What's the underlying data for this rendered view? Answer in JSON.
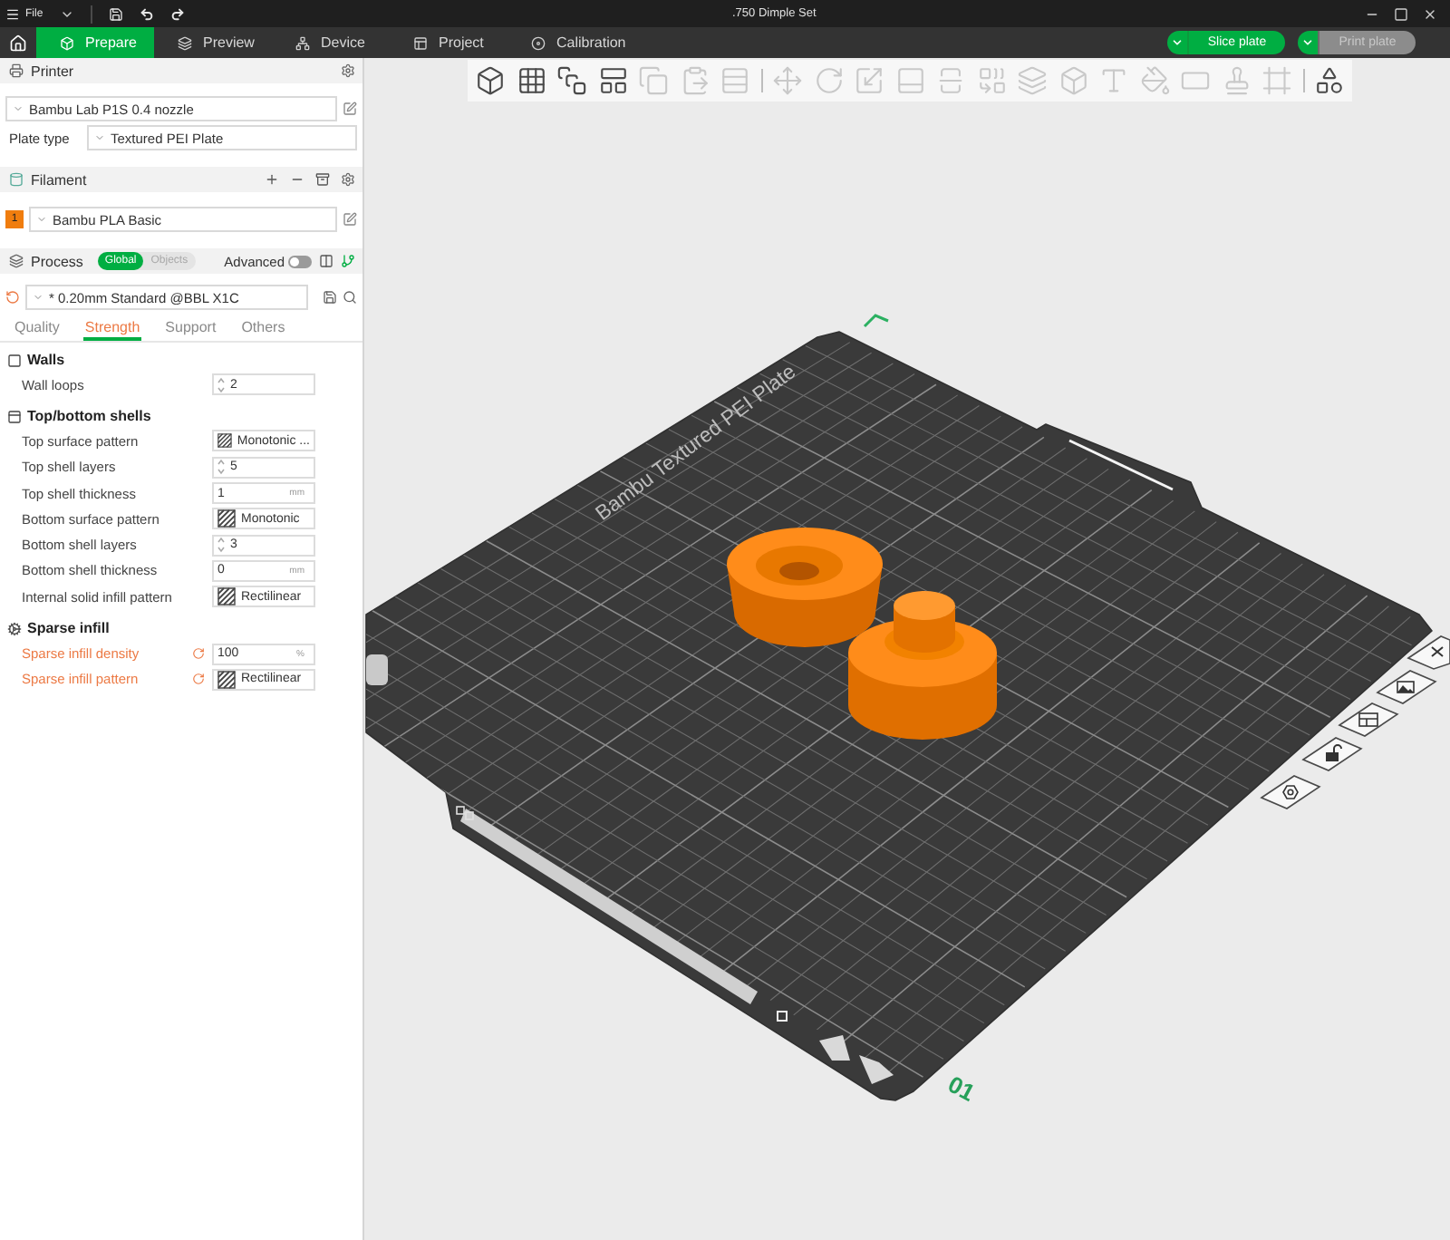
{
  "title_bar": {
    "menu": "File",
    "title": ".750 Dimple Set"
  },
  "tabs": [
    {
      "label": "Prepare",
      "selected": true
    },
    {
      "label": "Preview",
      "selected": false
    },
    {
      "label": "Device",
      "selected": false
    },
    {
      "label": "Project",
      "selected": false
    },
    {
      "label": "Calibration",
      "selected": false
    }
  ],
  "actions": [
    {
      "label": "Slice plate",
      "disabled": false
    },
    {
      "label": "Print plate",
      "disabled": true
    }
  ],
  "printer": {
    "title": "Printer",
    "preset": "Bambu Lab P1S 0.4 nozzle",
    "plate_type_label": "Plate type",
    "plate_type": "Textured PEI Plate"
  },
  "filament": {
    "title": "Filament",
    "items": [
      {
        "slot": "1",
        "name": "Bambu PLA Basic",
        "color": "#f07d0e"
      }
    ]
  },
  "process": {
    "title": "Process",
    "scope": [
      {
        "label": "Global",
        "selected": true
      },
      {
        "label": "Objects",
        "selected": false
      }
    ],
    "advanced_label": "Advanced",
    "advanced_on": false,
    "preset": "* 0.20mm Standard @BBL X1C"
  },
  "setting_tabs": [
    {
      "label": "Quality",
      "selected": false
    },
    {
      "label": "Strength",
      "selected": true
    },
    {
      "label": "Support",
      "selected": false
    },
    {
      "label": "Others",
      "selected": false
    }
  ],
  "sections": [
    {
      "title": "Walls",
      "rows": [
        {
          "label": "Wall loops",
          "kind": "spin",
          "value": "2",
          "modified": false
        }
      ]
    },
    {
      "title": "Top/bottom shells",
      "rows": [
        {
          "label": "Top surface pattern",
          "kind": "pattern",
          "value": "Monotonic ...",
          "modified": false
        },
        {
          "label": "Top shell layers",
          "kind": "spin",
          "value": "5",
          "modified": false
        },
        {
          "label": "Top shell thickness",
          "kind": "number",
          "value": "1",
          "unit": "mm",
          "modified": false
        },
        {
          "label": "Bottom surface pattern",
          "kind": "pattern",
          "value": "Monotonic",
          "modified": false
        },
        {
          "label": "Bottom shell layers",
          "kind": "spin",
          "value": "3",
          "modified": false
        },
        {
          "label": "Bottom shell thickness",
          "kind": "number",
          "value": "0",
          "unit": "mm",
          "modified": false
        },
        {
          "label": "Internal solid infill pattern",
          "kind": "pattern",
          "value": "Rectilinear",
          "modified": false
        }
      ]
    },
    {
      "title": "Sparse infill",
      "rows": [
        {
          "label": "Sparse infill density",
          "kind": "number",
          "value": "100",
          "unit": "%",
          "modified": true
        },
        {
          "label": "Sparse infill pattern",
          "kind": "pattern",
          "value": "Rectilinear",
          "modified": true
        }
      ]
    }
  ],
  "toolbar": {
    "groups": [
      {
        "tools": [
          {
            "disabled": false
          },
          {
            "disabled": false
          },
          {
            "disabled": false
          },
          {
            "disabled": false
          },
          {
            "disabled": true
          },
          {
            "disabled": true
          },
          {
            "disabled": true
          }
        ]
      },
      {
        "tools": [
          {
            "disabled": true
          },
          {
            "disabled": true
          },
          {
            "disabled": true
          },
          {
            "disabled": true
          },
          {
            "disabled": true
          },
          {
            "disabled": true
          },
          {
            "disabled": true
          },
          {
            "disabled": true
          },
          {
            "disabled": true
          },
          {
            "disabled": true
          },
          {
            "disabled": true
          },
          {
            "disabled": true
          },
          {
            "disabled": true
          }
        ]
      },
      {
        "tools": [
          {
            "disabled": false
          }
        ]
      }
    ]
  },
  "plate": {
    "name": "Bambu Textured PEI Plate",
    "number": "01"
  }
}
